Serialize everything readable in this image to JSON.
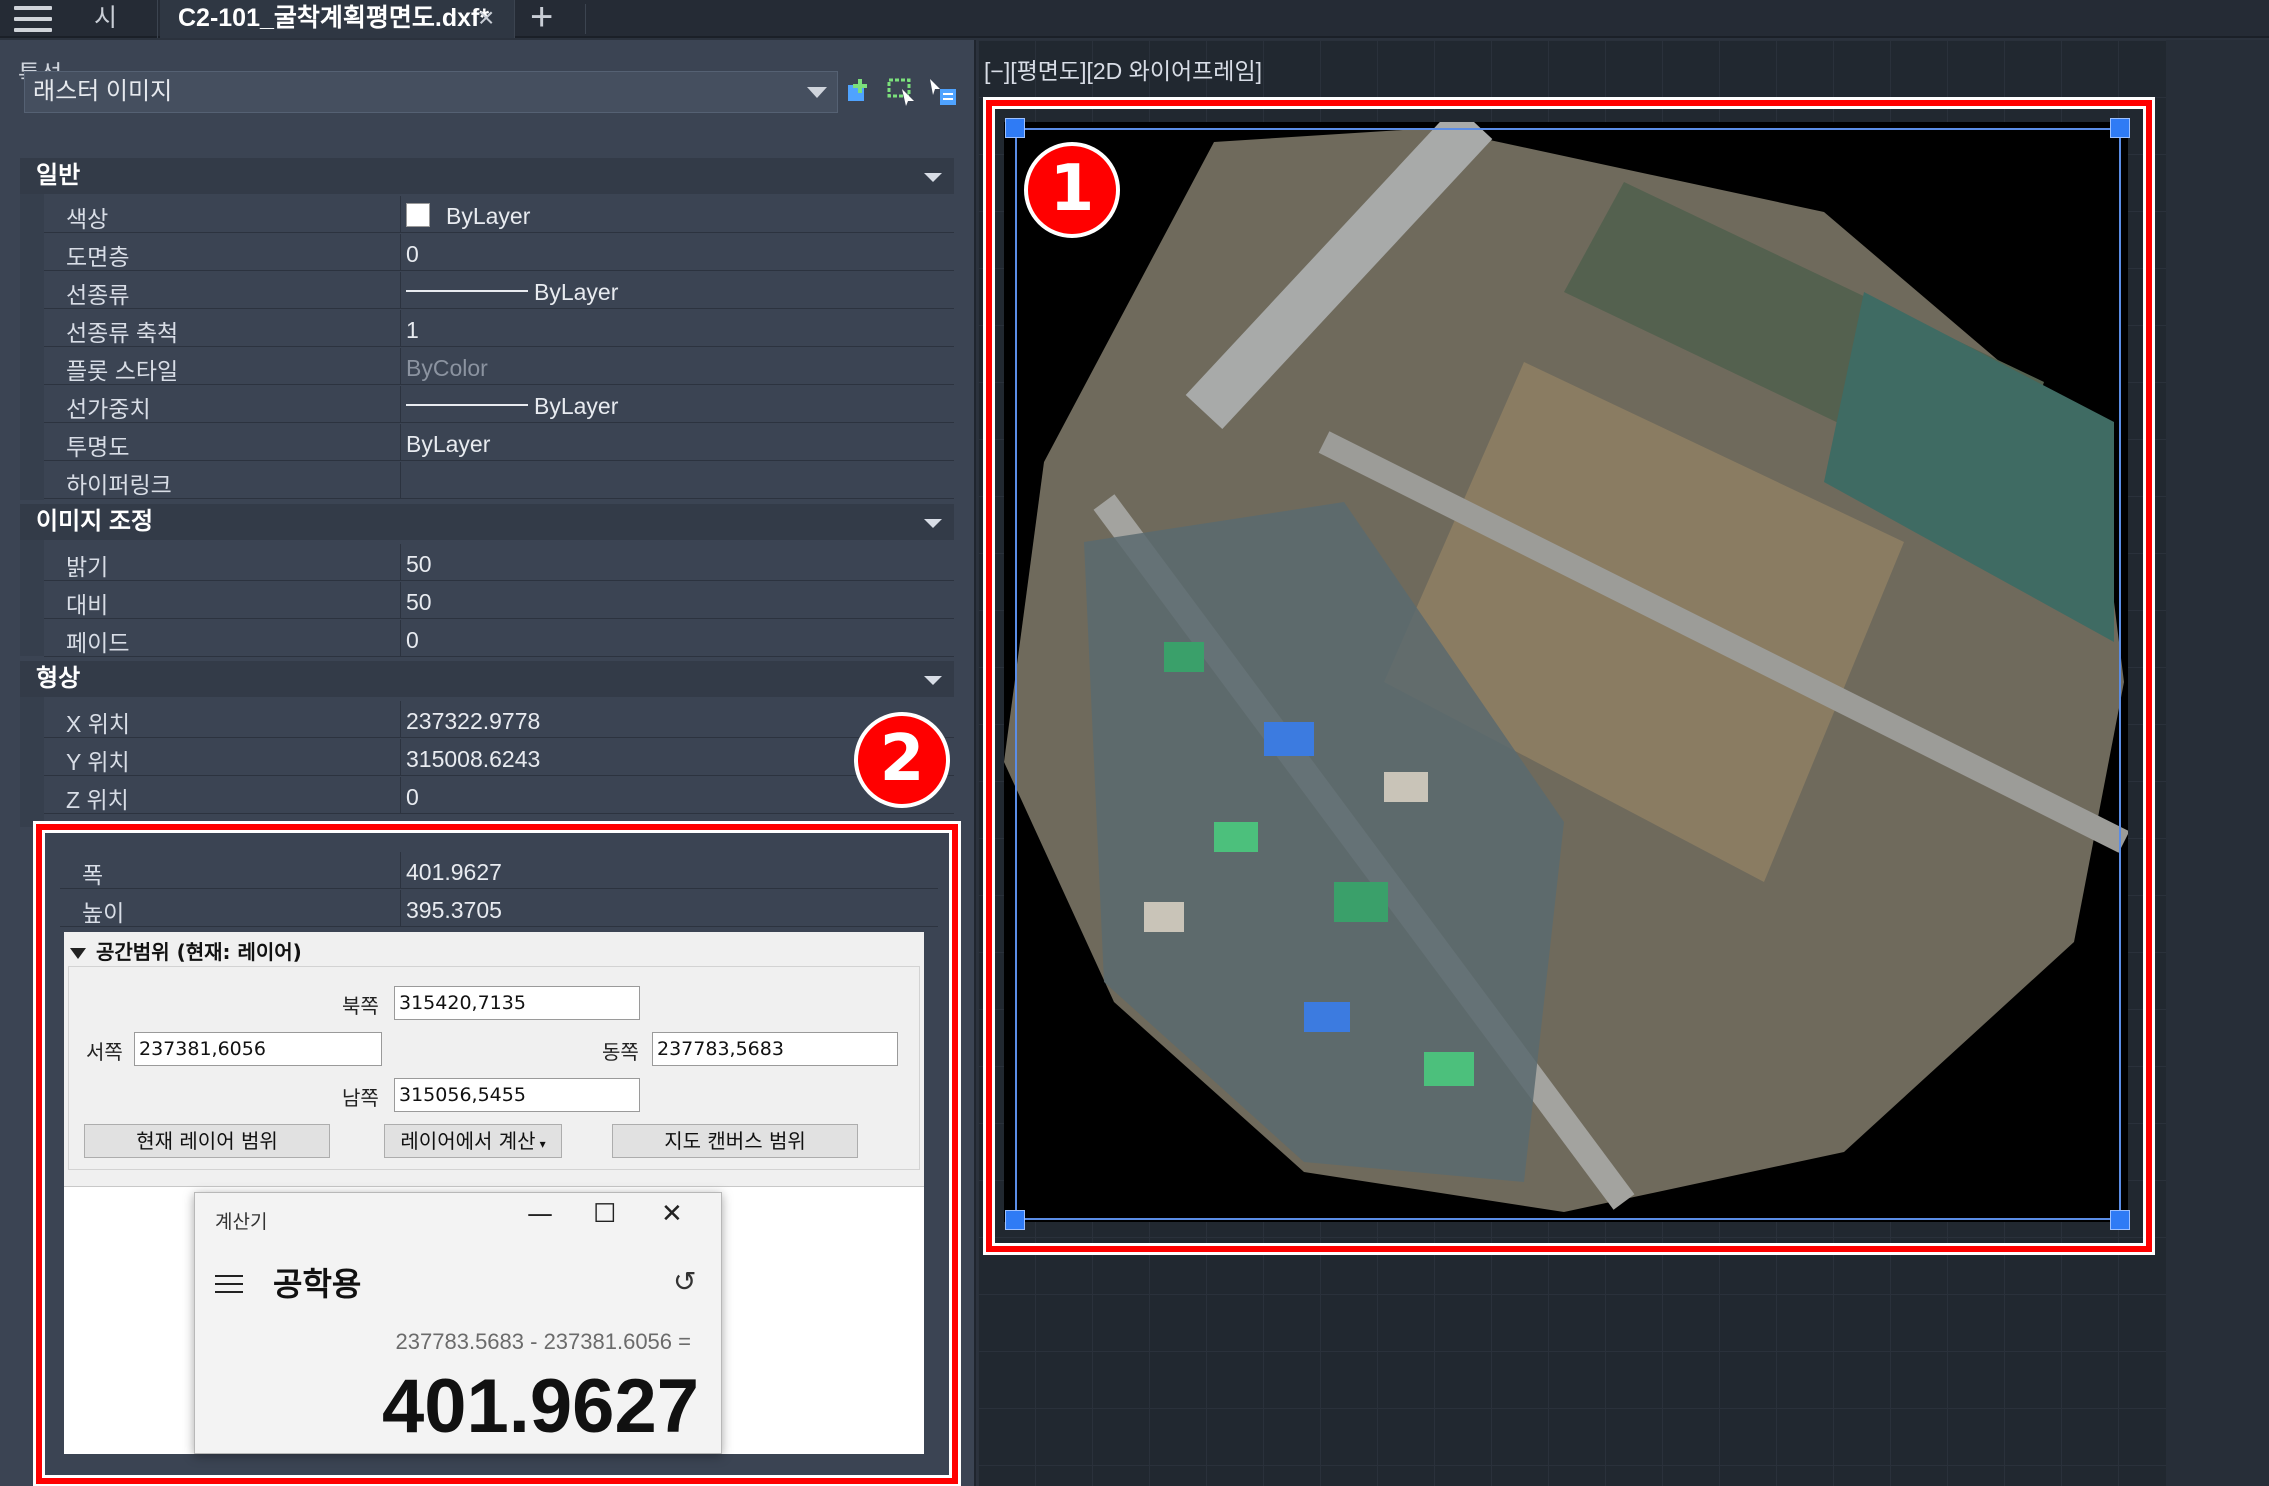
{
  "tabs": {
    "start_label": "시작",
    "active_label": "C2-101_굴착계획평면도.dxf*",
    "close_glyph": "×",
    "add_glyph": "+"
  },
  "properties": {
    "title": "특성",
    "object_type": "래스터 이미지",
    "sections": {
      "general": "일반",
      "image_adjust": "이미지 조정",
      "geometry": "형상"
    },
    "general": [
      {
        "key": "색상",
        "value": "ByLayer"
      },
      {
        "key": "도면층",
        "value": "0"
      },
      {
        "key": "선종류",
        "value": "ByLayer"
      },
      {
        "key": "선종류 축척",
        "value": "1"
      },
      {
        "key": "플롯 스타일",
        "value": "ByColor"
      },
      {
        "key": "선가중치",
        "value": "ByLayer"
      },
      {
        "key": "투명도",
        "value": "ByLayer"
      },
      {
        "key": "하이퍼링크",
        "value": ""
      }
    ],
    "image_adjust": [
      {
        "key": "밝기",
        "value": "50"
      },
      {
        "key": "대비",
        "value": "50"
      },
      {
        "key": "페이드",
        "value": "0"
      }
    ],
    "geometry": [
      {
        "key": "X 위치",
        "value": "237322.9778"
      },
      {
        "key": "Y 위치",
        "value": "315008.6243"
      },
      {
        "key": "Z 위치",
        "value": "0"
      },
      {
        "key": "폭",
        "value": "401.9627"
      },
      {
        "key": "높이",
        "value": "395.3705"
      }
    ]
  },
  "extent_dialog": {
    "header": "공간범위 (현재: 레이어)",
    "north_label": "북쪽",
    "north_value": "315420,7135",
    "west_label": "서쪽",
    "west_value": "237381,6056",
    "east_label": "동쪽",
    "east_value": "237783,5683",
    "south_label": "남쪽",
    "south_value": "315056,5455",
    "btn_current_layer": "현재 레이어 범위",
    "btn_calc_from_layer": "레이어에서 계산",
    "btn_map_canvas": "지도 캔버스 범위"
  },
  "calculator": {
    "title": "계산기",
    "mode": "공학용",
    "expression": "237783.5683 - 237381.6056 =",
    "result": "401.9627",
    "minimize_glyph": "—",
    "maximize_glyph": "☐",
    "close_glyph": "✕"
  },
  "viewport": {
    "label": "[−][평면도][2D 와이어프레임]"
  },
  "badges": {
    "one": "1",
    "two": "2"
  },
  "colors": {
    "highlight": "#ff0000",
    "selection": "#5b8de6",
    "grip": "#2f7bf5"
  }
}
